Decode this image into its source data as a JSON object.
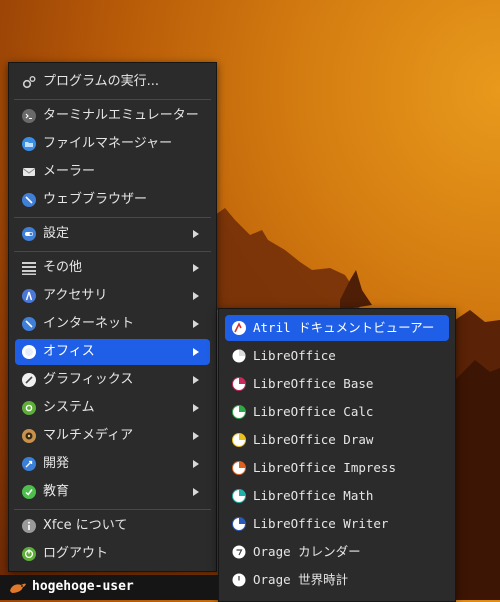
{
  "main_menu": {
    "items": [
      {
        "label": "プログラムの実行...",
        "icon": "gear-run-icon"
      },
      {
        "label": "ターミナルエミュレーター",
        "icon": "terminal-icon"
      },
      {
        "label": "ファイルマネージャー",
        "icon": "folder-icon"
      },
      {
        "label": "メーラー",
        "icon": "mail-icon"
      },
      {
        "label": "ウェブブラウザー",
        "icon": "browser-icon"
      },
      {
        "label": "設定",
        "icon": "settings-toggle-icon"
      },
      {
        "label": "その他",
        "icon": "list-icon"
      },
      {
        "label": "アクセサリ",
        "icon": "accessories-icon"
      },
      {
        "label": "インターネット",
        "icon": "internet-icon"
      },
      {
        "label": "オフィス",
        "icon": "office-icon",
        "active": true
      },
      {
        "label": "グラフィックス",
        "icon": "graphics-icon"
      },
      {
        "label": "システム",
        "icon": "system-icon"
      },
      {
        "label": "マルチメディア",
        "icon": "multimedia-icon"
      },
      {
        "label": "開発",
        "icon": "development-icon"
      },
      {
        "label": "教育",
        "icon": "education-icon"
      },
      {
        "label": "Xfce について",
        "icon": "info-icon"
      },
      {
        "label": "ログアウト",
        "icon": "logout-icon"
      }
    ]
  },
  "office_submenu": {
    "items": [
      {
        "label": "Atril ドキュメントビューアー",
        "icon": "atril-icon",
        "active": true
      },
      {
        "label": "LibreOffice",
        "icon": "libreoffice-icon"
      },
      {
        "label": "LibreOffice Base",
        "icon": "libreoffice-base-icon"
      },
      {
        "label": "LibreOffice Calc",
        "icon": "libreoffice-calc-icon"
      },
      {
        "label": "LibreOffice Draw",
        "icon": "libreoffice-draw-icon"
      },
      {
        "label": "LibreOffice Impress",
        "icon": "libreoffice-impress-icon"
      },
      {
        "label": "LibreOffice Math",
        "icon": "libreoffice-math-icon"
      },
      {
        "label": "LibreOffice Writer",
        "icon": "libreoffice-writer-icon"
      },
      {
        "label": "Orage カレンダー",
        "icon": "calendar-icon"
      },
      {
        "label": "Orage 世界時計",
        "icon": "clock-icon"
      }
    ]
  },
  "taskbar": {
    "user_label": "hogehoge-user",
    "icon": "whisker-menu-icon"
  },
  "colors": {
    "highlight": "#1f5fe8",
    "menu_bg": "#2b2b2b"
  }
}
